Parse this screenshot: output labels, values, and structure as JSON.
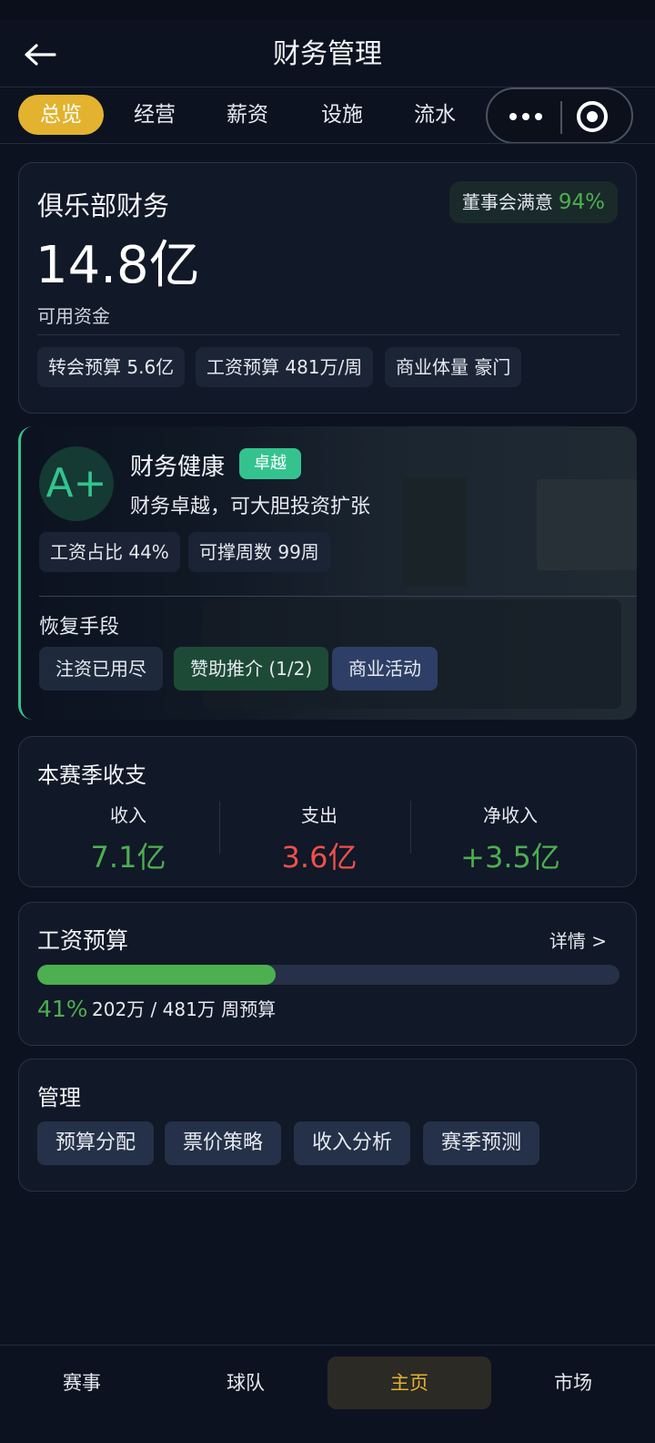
{
  "header": {
    "title": "财务管理"
  },
  "tabs": [
    {
      "label": "总览",
      "active": true
    },
    {
      "label": "经营"
    },
    {
      "label": "薪资"
    },
    {
      "label": "设施"
    },
    {
      "label": "流水"
    }
  ],
  "finance": {
    "title": "俱乐部财务",
    "satisfaction_label": "董事会满意",
    "satisfaction_value": "94%",
    "amount": "14.8亿",
    "amount_label": "可用资金",
    "chips": [
      "转会预算 5.6亿",
      "工资预算 481万/周",
      "商业体量 豪门"
    ]
  },
  "health": {
    "grade": "A+",
    "title": "财务健康",
    "badge": "卓越",
    "description": "财务卓越，可大胆投资扩张",
    "chips": [
      "工资占比 44%",
      "可撑周数 99周"
    ],
    "recovery_title": "恢复手段",
    "recovery_actions": [
      "注资已用尽",
      "赞助推介 (1/2)",
      "商业活动"
    ]
  },
  "season": {
    "title": "本赛季收支",
    "income_label": "收入",
    "income_value": "7.1亿",
    "expense_label": "支出",
    "expense_value": "3.6亿",
    "net_label": "净收入",
    "net_value": "+3.5亿"
  },
  "salary": {
    "title": "工资预算",
    "details": "详情 >",
    "percent_text": "41%",
    "fill_fraction": 0.41,
    "usage": "202万 / 481万 周预算"
  },
  "management": {
    "title": "管理",
    "buttons": [
      "预算分配",
      "票价策略",
      "收入分析",
      "赛季预测"
    ]
  },
  "bottom_nav": [
    {
      "label": "赛事"
    },
    {
      "label": "球队"
    },
    {
      "label": "主页",
      "active": true
    },
    {
      "label": "市场"
    }
  ],
  "colors": {
    "accent": "#e3b22e",
    "positive": "#4caf50",
    "negative": "#f0504a",
    "health": "#34c38f"
  }
}
